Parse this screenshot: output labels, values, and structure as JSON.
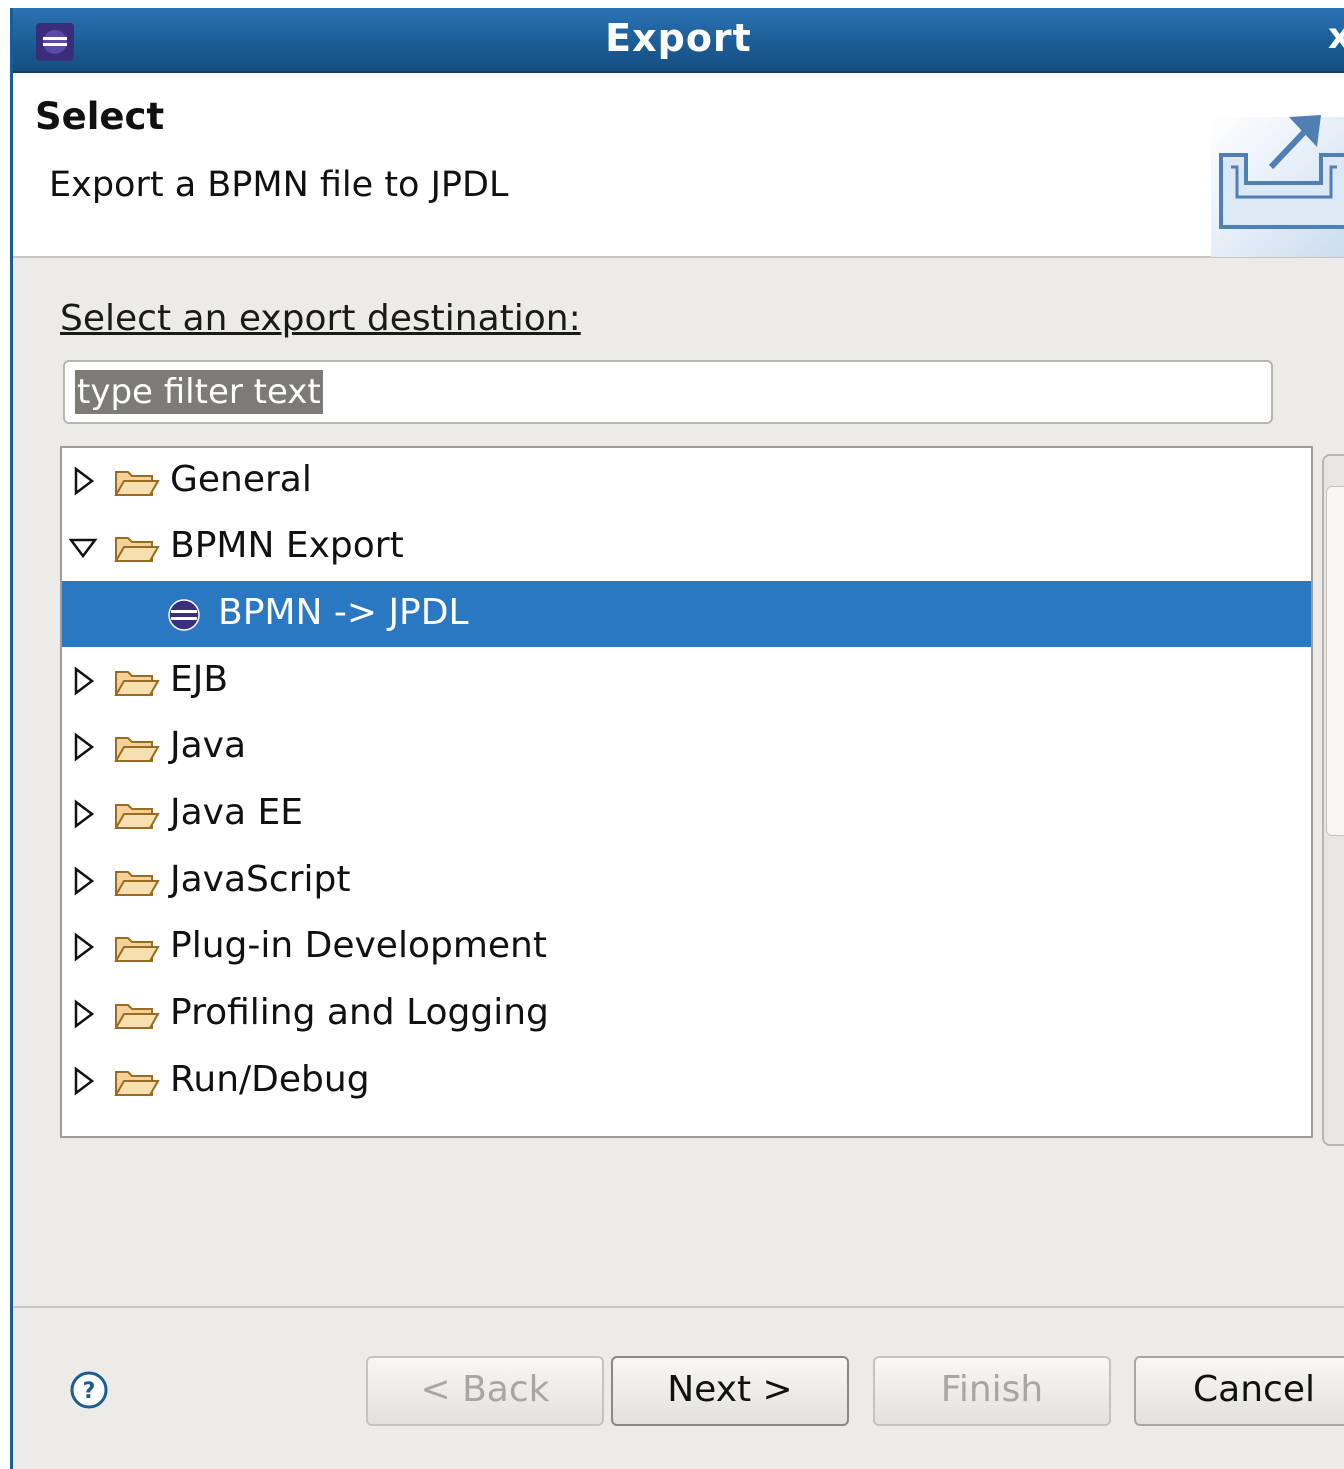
{
  "window": {
    "title": "Export",
    "close_glyph": "x"
  },
  "header": {
    "title": "Select",
    "description": "Export a BPMN file to JPDL",
    "banner_icon": "export-wizard-icon"
  },
  "main": {
    "destination_label": "Select an export destination:",
    "filter": {
      "value": "type filter text",
      "selected": true
    },
    "tree": [
      {
        "label": "General",
        "expanded": false,
        "type": "folder"
      },
      {
        "label": "BPMN Export",
        "expanded": true,
        "type": "folder"
      },
      {
        "label": "BPMN -> JPDL",
        "type": "leaf",
        "selected": true
      },
      {
        "label": "EJB",
        "expanded": false,
        "type": "folder"
      },
      {
        "label": "Java",
        "expanded": false,
        "type": "folder"
      },
      {
        "label": "Java EE",
        "expanded": false,
        "type": "folder"
      },
      {
        "label": "JavaScript",
        "expanded": false,
        "type": "folder"
      },
      {
        "label": "Plug-in Development",
        "expanded": false,
        "type": "folder"
      },
      {
        "label": "Profiling and Logging",
        "expanded": false,
        "type": "folder"
      },
      {
        "label": "Run/Debug",
        "expanded": false,
        "type": "folder"
      }
    ]
  },
  "footer": {
    "help_icon": "help-icon",
    "back_label": "< Back",
    "next_label": "Next >",
    "finish_label": "Finish",
    "cancel_label": "Cancel"
  },
  "colors": {
    "titlebar": "#1c5d96",
    "selection": "#2b78c2",
    "dialog_bg": "#edebe7"
  }
}
